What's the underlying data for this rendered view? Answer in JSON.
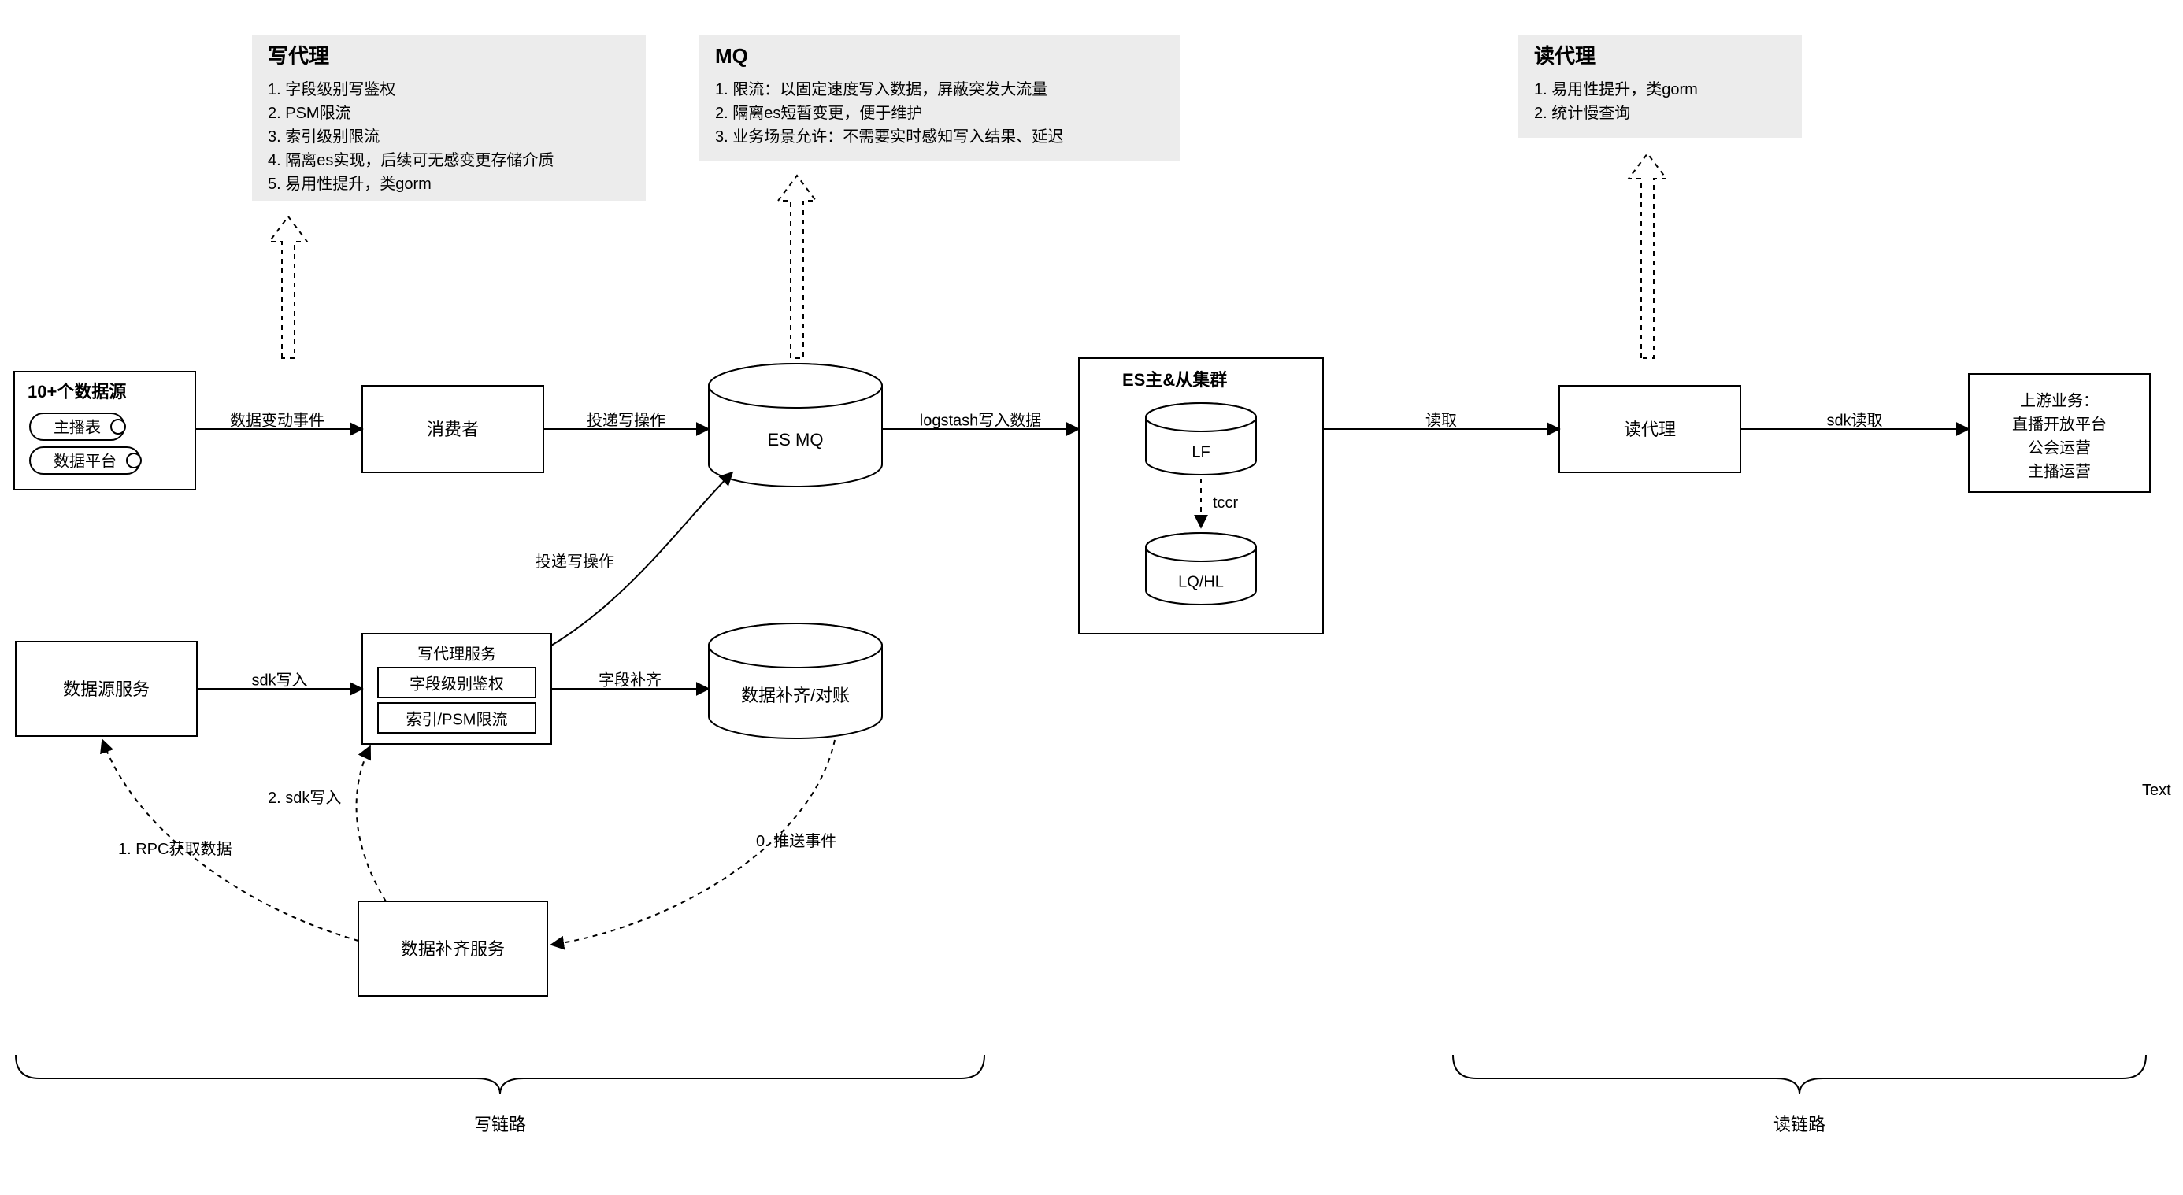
{
  "notes": {
    "write": {
      "title": "写代理",
      "items": [
        "1. 字段级别写鉴权",
        "2. PSM限流",
        "3. 索引级别限流",
        "4. 隔离es实现，后续可无感变更存储介质",
        "5. 易用性提升，类gorm"
      ]
    },
    "mq": {
      "title": "MQ",
      "items": [
        "1. 限流：以固定速度写入数据，屏蔽突发大流量",
        "2. 隔离es短暂变更，便于维护",
        "3. 业务场景允许：不需要实时感知写入结果、延迟"
      ]
    },
    "read": {
      "title": "读代理",
      "items": [
        "1. 易用性提升，类gorm",
        "2. 统计慢查询"
      ]
    }
  },
  "boxes": {
    "datasource": {
      "title": "10+个数据源",
      "pill1": "主播表",
      "pill2": "数据平台"
    },
    "consumer": "消费者",
    "esmq": "ES MQ",
    "esCluster": {
      "title": "ES主&从集群",
      "db1": "LF",
      "db2": "LQ/HL",
      "edge": "tccr"
    },
    "readProxy": "读代理",
    "upstream": {
      "l1": "上游业务：",
      "l2": "直播开放平台",
      "l3": "公会运营",
      "l4": "主播运营"
    },
    "dsService": "数据源服务",
    "writeProxy": {
      "title": "写代理服务",
      "r1": "字段级别鉴权",
      "r2": "索引/PSM限流"
    },
    "align": "数据补齐/对账",
    "alignService": "数据补齐服务"
  },
  "edges": {
    "e1": "数据变动事件",
    "e2": "投递写操作",
    "e3": "logstash写入数据",
    "e4": "读取",
    "e5": "sdk读取",
    "e6": "sdk写入",
    "e7": "字段补齐",
    "e8": "投递写操作",
    "d0": "0. 推送事件",
    "d1": "1. RPC获取数据",
    "d2": "2. sdk写入"
  },
  "sections": {
    "write": "写链路",
    "read": "读链路"
  },
  "stray": "Text"
}
